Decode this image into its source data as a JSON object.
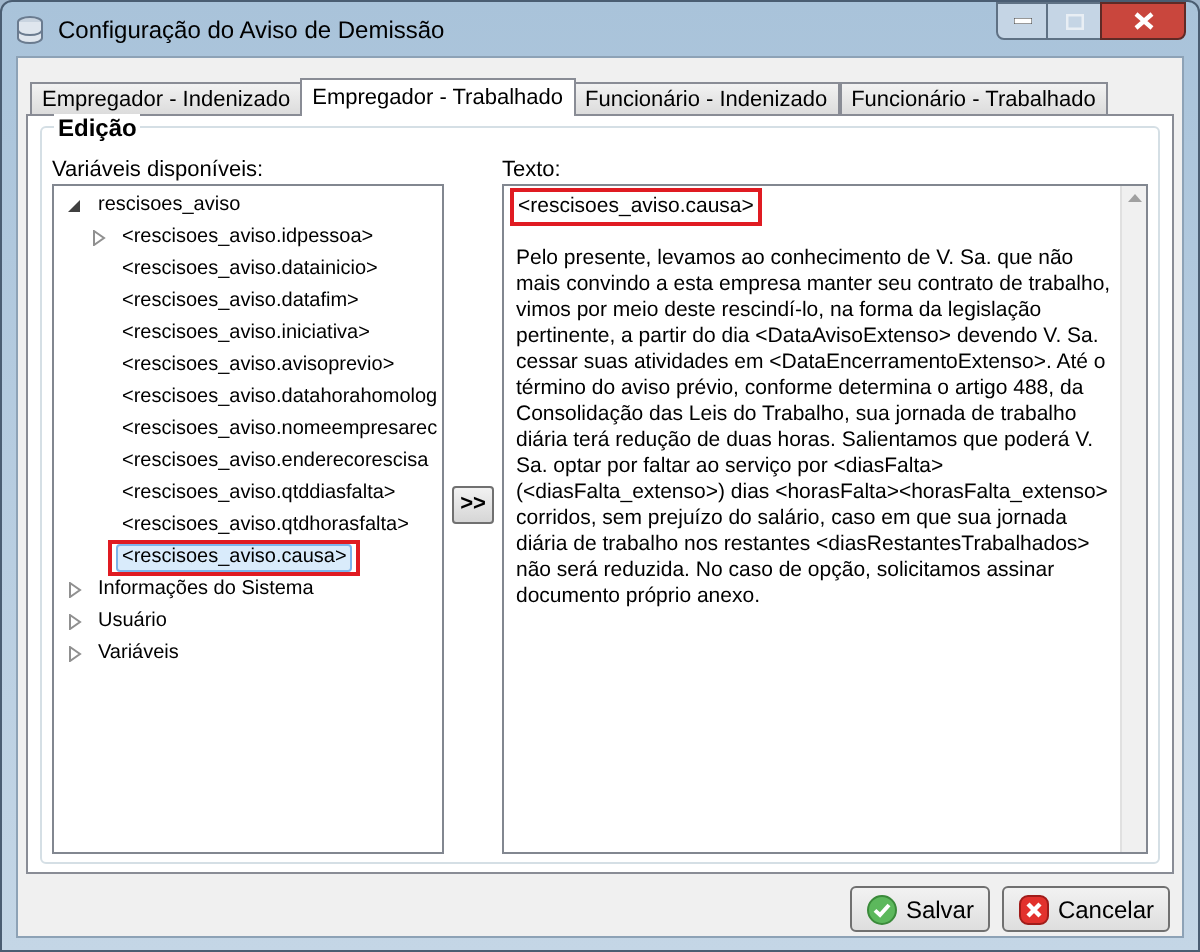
{
  "window": {
    "title": "Configuração do Aviso de Demissão"
  },
  "tabs": [
    {
      "label": "Empregador - Indenizado",
      "selected": false
    },
    {
      "label": "Empregador - Trabalhado",
      "selected": true
    },
    {
      "label": "Funcionário - Indenizado",
      "selected": false
    },
    {
      "label": "Funcionário - Trabalhado",
      "selected": false
    }
  ],
  "group": {
    "title": "Edição"
  },
  "variables": {
    "label": "Variáveis disponíveis:",
    "tree": [
      {
        "label": "rescisoes_aviso",
        "expanded": true,
        "selected": false,
        "marked": false,
        "children": [
          {
            "label": "<rescisoes_aviso.idpessoa>",
            "expanded": false,
            "selected": false,
            "marked": false
          },
          {
            "label": "<rescisoes_aviso.datainicio>",
            "selected": false,
            "marked": false
          },
          {
            "label": "<rescisoes_aviso.datafim>",
            "selected": false,
            "marked": false
          },
          {
            "label": "<rescisoes_aviso.iniciativa>",
            "selected": false,
            "marked": false
          },
          {
            "label": "<rescisoes_aviso.avisoprevio>",
            "selected": false,
            "marked": false
          },
          {
            "label": "<rescisoes_aviso.datahorahomolog",
            "selected": false,
            "marked": false
          },
          {
            "label": "<rescisoes_aviso.nomeempresarec",
            "selected": false,
            "marked": false
          },
          {
            "label": "<rescisoes_aviso.enderecorescisa",
            "selected": false,
            "marked": false
          },
          {
            "label": "<rescisoes_aviso.qtddiasfalta>",
            "selected": false,
            "marked": false
          },
          {
            "label": "<rescisoes_aviso.qtdhorasfalta>",
            "selected": false,
            "marked": false
          },
          {
            "label": "<rescisoes_aviso.causa>",
            "selected": true,
            "marked": true
          }
        ]
      },
      {
        "label": "Informações do Sistema",
        "expanded": false,
        "selected": false,
        "marked": false
      },
      {
        "label": "Usuário",
        "expanded": false,
        "selected": false,
        "marked": false
      },
      {
        "label": "Variáveis",
        "expanded": false,
        "selected": false,
        "marked": false
      }
    ]
  },
  "insert_button": {
    "label": ">>"
  },
  "text": {
    "label": "Texto:",
    "paragraphs": [
      {
        "text": "<rescisoes_aviso.causa>",
        "marked": true
      },
      {
        "text": "Pelo presente, levamos ao conhecimento de V. Sa. que não mais convindo a esta empresa manter seu contrato de trabalho, vimos por meio deste rescindí-lo, na forma da legislação pertinente, a partir do dia <DataAvisoExtenso> devendo V. Sa. cessar suas atividades em <DataEncerramentoExtenso>. Até o término do aviso prévio, conforme determina o artigo 488, da Consolidação das Leis do Trabalho, sua jornada de trabalho diária terá redução de duas horas. Salientamos que poderá V. Sa. optar por faltar ao serviço por <diasFalta> (<diasFalta_extenso>) dias <horasFalta><horasFalta_extenso> corridos, sem prejuízo do salário, caso em que sua jornada diária de trabalho nos restantes <diasRestantesTrabalhados> não será reduzida. No caso de opção, solicitamos assinar documento próprio anexo.",
        "marked": false
      }
    ]
  },
  "buttons": [
    {
      "label": "Salvar",
      "kind": "save"
    },
    {
      "label": "Cancelar",
      "kind": "cancel"
    }
  ]
}
